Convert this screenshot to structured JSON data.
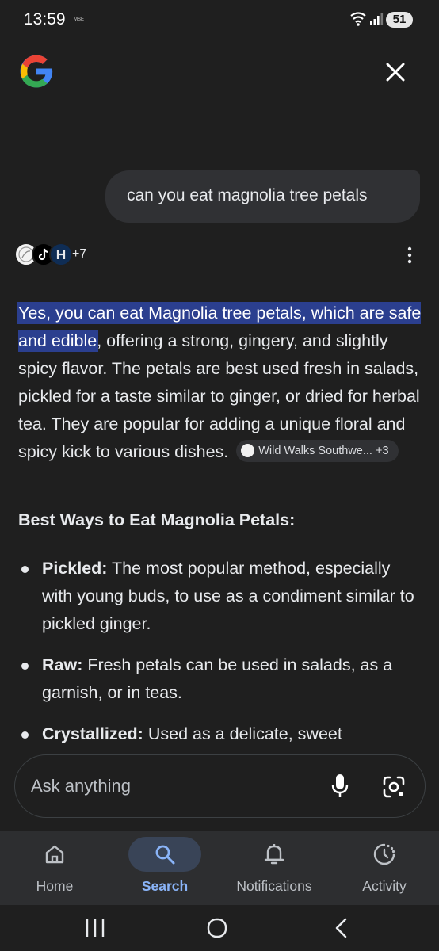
{
  "status_bar": {
    "time": "13:59",
    "carrier_tag": "MSE",
    "battery": "51"
  },
  "header": {
    "logo_icon": "google-g-icon",
    "close_icon": "close-icon"
  },
  "query": {
    "text": "can you eat magnolia tree petals"
  },
  "sources": {
    "more_count": "+7"
  },
  "answer": {
    "highlight": "Yes, you can eat Magnolia tree petals, which are safe and edible",
    "body": ", offering a strong, gingery, and slightly spicy flavor. The petals are best used fresh in salads, pickled for a taste similar to ginger, or dried for herbal tea. They are popular for adding a unique floral and spicy kick to various dishes.",
    "citation_label": "Wild Walks Southwe...",
    "citation_more": "+3",
    "section_heading": "Best Ways to Eat Magnolia Petals:",
    "bullets": [
      {
        "term": "Pickled:",
        "text": " The most popular method, especially with young buds, to use as a condiment similar to pickled ginger."
      },
      {
        "term": "Raw:",
        "text": " Fresh petals can be used in salads, as a garnish, or in teas."
      },
      {
        "term": "Crystallized:",
        "text": " Used as a delicate, sweet"
      }
    ]
  },
  "ask": {
    "placeholder": "Ask anything"
  },
  "bottom_nav": {
    "items": [
      {
        "label": "Home",
        "icon": "home-icon"
      },
      {
        "label": "Search",
        "icon": "search-icon",
        "active": true
      },
      {
        "label": "Notifications",
        "icon": "bell-icon"
      },
      {
        "label": "Activity",
        "icon": "activity-icon"
      }
    ]
  },
  "colors": {
    "background": "#1f1f1f",
    "highlight": "#2b3f8f",
    "accent": "#8ab4f8",
    "nav_background": "#2d2e30"
  }
}
